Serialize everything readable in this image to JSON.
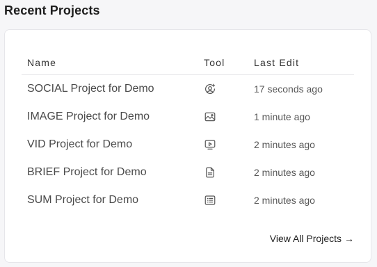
{
  "section": {
    "title": "Recent Projects"
  },
  "table": {
    "headers": {
      "name": "Name",
      "tool": "Tool",
      "last_edit": "Last Edit"
    },
    "rows": [
      {
        "name": "SOCIAL Project for Demo",
        "tool_icon": "social-user-icon",
        "last_edit": "17 seconds ago"
      },
      {
        "name": "IMAGE Project for Demo",
        "tool_icon": "image-icon",
        "last_edit": "1 minute ago"
      },
      {
        "name": "VID Project for Demo",
        "tool_icon": "video-icon",
        "last_edit": "2 minutes ago"
      },
      {
        "name": "BRIEF Project for Demo",
        "tool_icon": "document-icon",
        "last_edit": "2 minutes ago"
      },
      {
        "name": "SUM Project for Demo",
        "tool_icon": "list-icon",
        "last_edit": "2 minutes ago"
      }
    ]
  },
  "footer": {
    "view_all_label": "View All Projects",
    "view_all_arrow": "→"
  },
  "colors": {
    "background": "#f6f6f8",
    "card": "#ffffff",
    "icon": "#555555"
  }
}
